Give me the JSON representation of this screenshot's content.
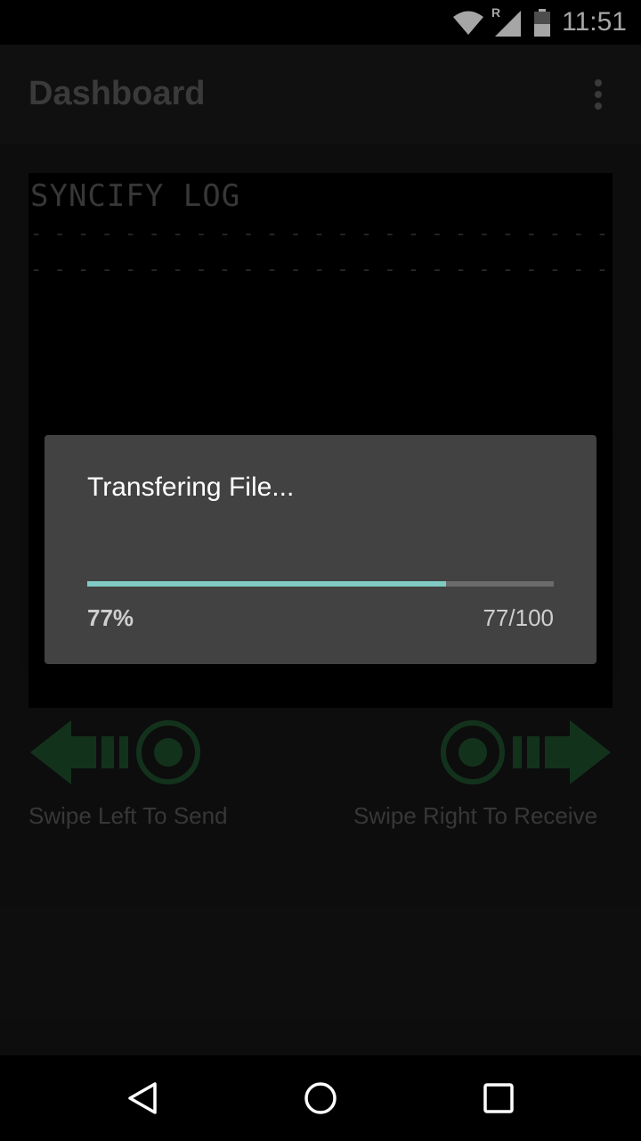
{
  "status_bar": {
    "time": "11:51",
    "roaming_indicator": "R",
    "icons": [
      "wifi-icon",
      "signal-icon",
      "battery-icon"
    ]
  },
  "app_bar": {
    "title": "Dashboard",
    "overflow_icon": "overflow-menu-icon"
  },
  "log": {
    "title": "SYNCIFY LOG",
    "separator_1": "- - - - - - - - - - - - - - - - - - - - - - - - -",
    "separator_2": "- - - - - - - - - - - - - - - - - - - - - - - - -"
  },
  "swipe": {
    "left_label": "Swipe Left To Send",
    "right_label": "Swipe Right To Receive",
    "left_icon": "swipe-left-arrow-icon",
    "right_icon": "swipe-right-arrow-icon",
    "icon_color": "#1e4d2b"
  },
  "dialog": {
    "title": "Transfering File...",
    "progress_percent_label": "77%",
    "progress_count_label": "77/100",
    "progress_fraction": 0.77,
    "progress_color": "#80cbc4"
  },
  "nav_bar": {
    "icons": [
      "back-icon",
      "home-icon",
      "recents-icon"
    ]
  }
}
